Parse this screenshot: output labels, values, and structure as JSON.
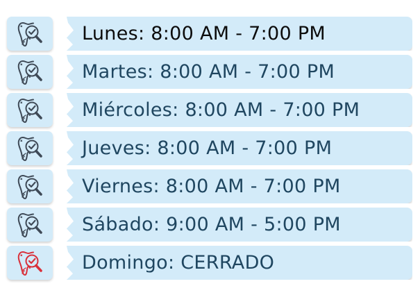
{
  "rows": [
    {
      "label": "Lunes: 8:00 AM - 7:00 PM",
      "icon": "tooth-check-icon",
      "status": "open"
    },
    {
      "label": "Martes: 8:00 AM - 7:00 PM",
      "icon": "tooth-check-icon",
      "status": "open"
    },
    {
      "label": "Miércoles: 8:00 AM - 7:00 PM",
      "icon": "tooth-check-icon",
      "status": "open"
    },
    {
      "label": "Jueves: 8:00 AM - 7:00 PM",
      "icon": "tooth-check-icon",
      "status": "open"
    },
    {
      "label": "Viernes: 8:00 AM - 7:00 PM",
      "icon": "tooth-check-icon",
      "status": "open"
    },
    {
      "label": "Sábado: 9:00 AM - 5:00 PM",
      "icon": "tooth-check-icon",
      "status": "open"
    },
    {
      "label": "Domingo: CERRADO",
      "icon": "tooth-check-icon",
      "status": "closed"
    }
  ],
  "colors": {
    "tile_background": "#d3ebf9",
    "text": "#1f4660",
    "icon_open": "#3f4a57",
    "icon_closed": "#d9303a"
  }
}
